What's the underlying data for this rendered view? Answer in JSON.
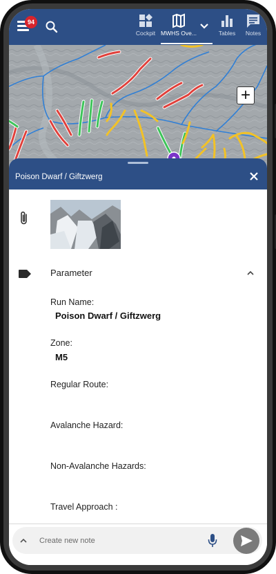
{
  "appbar": {
    "notification_count": "94",
    "nav": [
      {
        "label": "Cockpit",
        "icon": "cockpit-icon"
      },
      {
        "label": "MWHS Ove...",
        "icon": "map-icon",
        "active": true
      },
      {
        "label": "Tables",
        "icon": "bar-chart-icon"
      },
      {
        "label": "Notes",
        "icon": "notes-icon"
      }
    ]
  },
  "map": {
    "zoom_in_label": "+"
  },
  "sheet": {
    "title": "Poison Dwarf / Giftzwerg",
    "section": "Parameter",
    "fields": [
      {
        "label": "Run Name:",
        "value": "Poison Dwarf / Giftzwerg"
      },
      {
        "label": "Zone:",
        "value": "M5"
      },
      {
        "label": "Regular Route:",
        "value": ""
      },
      {
        "label": "Avalanche Hazard:",
        "value": ""
      },
      {
        "label": "Non-Avalanche Hazards:",
        "value": ""
      },
      {
        "label": "Travel Approach :",
        "value": ""
      }
    ]
  },
  "note_input": {
    "placeholder": "Create new note"
  },
  "colors": {
    "primary": "#2d4f86",
    "badge": "#d8242c",
    "route_red": "#e0413c",
    "route_yellow": "#f2c227",
    "route_green": "#3ec45a",
    "route_blue": "#2f7fd6",
    "pin": "#7b35c9"
  }
}
